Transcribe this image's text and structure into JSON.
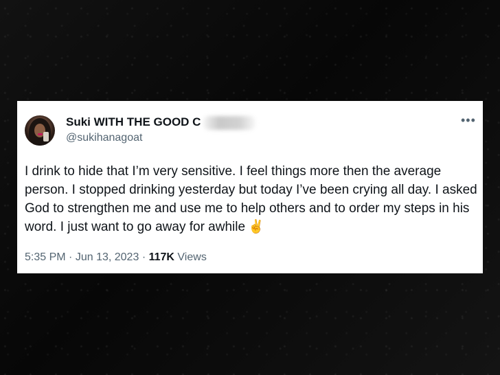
{
  "tweet": {
    "display_name": "Suki WITH THE GOOD C",
    "handle": "@sukihanagoat",
    "more_icon": "more-horizontal-icon",
    "text": "I drink to hide that I’m very sensitive. I feel things more then the average person. I stopped drinking yesterday but today I’ve been crying all day. I asked God to strengthen me and use me to help others and to order my steps in his word. I just want to go away for awhile",
    "emoji": "✌",
    "time": "5:35 PM",
    "separator": "·",
    "date": "Jun 13, 2023",
    "views_count": "117K",
    "views_label": "Views"
  },
  "colors": {
    "text_primary": "#0f1419",
    "text_secondary": "#536471",
    "card_background": "#ffffff",
    "page_background": "#0b0b0b"
  }
}
